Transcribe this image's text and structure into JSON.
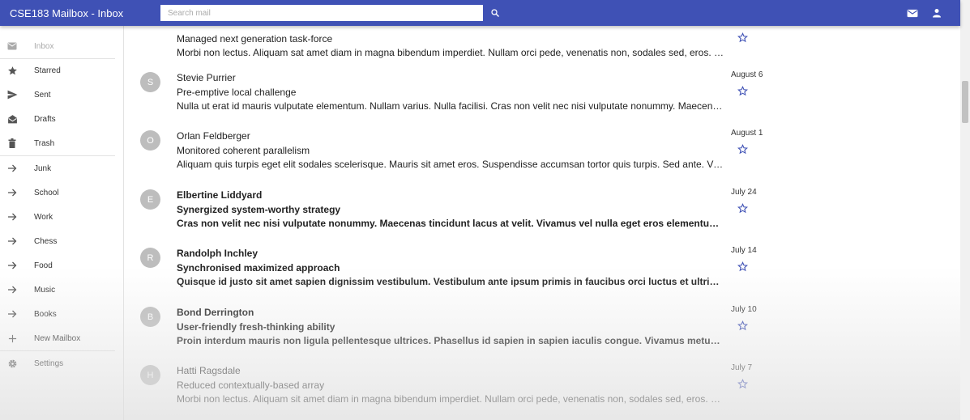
{
  "app": {
    "title": "CSE183 Mailbox - Inbox"
  },
  "search": {
    "placeholder": "Search mail",
    "value": ""
  },
  "header_icons": {
    "search": "search-icon",
    "mail": "mail-icon",
    "account": "person-icon",
    "color": "#3f51b5"
  },
  "sidebar": {
    "items": [
      {
        "label": "Inbox",
        "icon": "inbox-icon",
        "selected": true
      },
      {
        "label": "Starred",
        "icon": "star-icon"
      },
      {
        "label": "Sent",
        "icon": "send-icon"
      },
      {
        "label": "Drafts",
        "icon": "drafts-icon"
      },
      {
        "label": "Trash",
        "icon": "trash-icon"
      },
      {
        "label": "Junk",
        "icon": "arrow-right-icon"
      },
      {
        "label": "School",
        "icon": "arrow-right-icon"
      },
      {
        "label": "Work",
        "icon": "arrow-right-icon"
      },
      {
        "label": "Chess",
        "icon": "arrow-right-icon"
      },
      {
        "label": "Food",
        "icon": "arrow-right-icon"
      },
      {
        "label": "Music",
        "icon": "arrow-right-icon"
      },
      {
        "label": "Books",
        "icon": "arrow-right-icon"
      },
      {
        "label": "New Mailbox",
        "icon": "plus-icon"
      },
      {
        "label": "Settings",
        "icon": "gear-icon"
      }
    ]
  },
  "emails": [
    {
      "initial": "",
      "sender": "",
      "subject": "Managed next generation task-force",
      "preview": "Morbi non lectus. Aliquam sat amet diam in magna bibendum imperdiet. Nullam orci pede, venenatis non, sodales sed, eros. Praesent blandit.",
      "date": "",
      "unread": false
    },
    {
      "initial": "S",
      "sender": "Stevie Purrier",
      "subject": "Pre-emptive local challenge",
      "preview": "Nulla ut erat id mauris vulputate elementum. Nullam varius. Nulla facilisi. Cras non velit nec nisi vulputate nonummy. Maecenas tincidunt.",
      "date": "August 6",
      "unread": false
    },
    {
      "initial": "O",
      "sender": "Orlan Feldberger",
      "subject": "Monitored coherent parallelism",
      "preview": "Aliquam quis turpis eget elit sodales scelerisque. Mauris sit amet eros. Suspendisse accumsan tortor quis turpis. Sed ante. Vivamus tortor.",
      "date": "August 1",
      "unread": false
    },
    {
      "initial": "E",
      "sender": "Elbertine Liddyard",
      "subject": "Synergized system-worthy strategy",
      "preview": "Cras non velit nec nisi vulputate nonummy. Maecenas tincidunt lacus at velit. Vivamus vel nulla eget eros elementum pellentesque.",
      "date": "July 24",
      "unread": true
    },
    {
      "initial": "R",
      "sender": "Randolph Inchley",
      "subject": "Synchronised maximized approach",
      "preview": "Quisque id justo sit amet sapien dignissim vestibulum. Vestibulum ante ipsum primis in faucibus orci luctus et ultrices posuere cubilia.",
      "date": "July 14",
      "unread": true
    },
    {
      "initial": "B",
      "sender": "Bond Derrington",
      "subject": "User-friendly fresh-thinking ability",
      "preview": "Proin interdum mauris non ligula pellentesque ultrices. Phasellus id sapien in sapien iaculis congue. Vivamus metus arcu, adipiscing molestie.",
      "date": "July 10",
      "unread": true
    },
    {
      "initial": "H",
      "sender": "Hatti Ragsdale",
      "subject": "Reduced contextually-based array",
      "preview": "Morbi non lectus. Aliquam sit amet diam in magna bibendum imperdiet. Nullam orci pede, venenatis non, sodales sed, eros. Praesent blandit.",
      "date": "July 7",
      "unread": false
    }
  ]
}
